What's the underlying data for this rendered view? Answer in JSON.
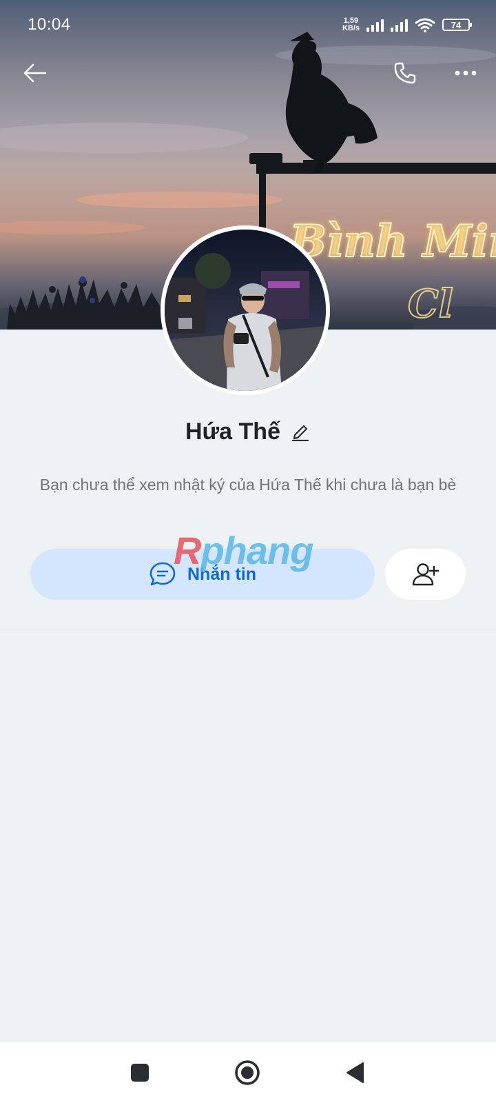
{
  "status_bar": {
    "time": "10:04",
    "net_speed_value": "1,59",
    "net_speed_unit": "KB/s",
    "battery": "74"
  },
  "cover": {
    "sign_text": "Bình Minh"
  },
  "profile": {
    "name": "Hứa Thế",
    "privacy_message": "Bạn chưa thể xem nhật ký của Hứa Thế khi chưa là bạn bè"
  },
  "actions": {
    "message_label": "Nhắn tin"
  },
  "watermark": {
    "text_first": "R",
    "text_rest": "phang"
  },
  "icons": {
    "back": "arrow-left-icon",
    "call": "phone-icon",
    "more": "more-horizontal-icon",
    "edit": "pencil-icon",
    "message": "chat-bubble-icon",
    "add_friend": "add-user-icon",
    "nav_recents": "square-icon",
    "nav_home": "circle-icon",
    "nav_back": "triangle-back-icon"
  },
  "colors": {
    "accent": "#1068d1",
    "message_button_bg": "#d4e6fd",
    "page_bg": "#eef1f4",
    "neon_sign": "#ffd96a"
  }
}
